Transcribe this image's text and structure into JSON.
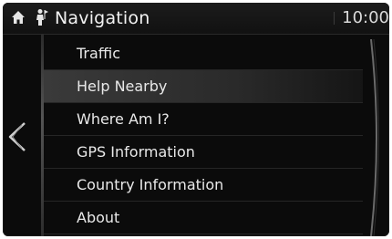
{
  "header": {
    "title": "Navigation",
    "clock": "10:00",
    "home_icon": "home-icon",
    "navigation_icon": "navigation-person-icon"
  },
  "menu": {
    "items": [
      {
        "label": "Traffic",
        "highlighted": false
      },
      {
        "label": "Help Nearby",
        "highlighted": true
      },
      {
        "label": "Where Am I?",
        "highlighted": false
      },
      {
        "label": "GPS Information",
        "highlighted": false
      },
      {
        "label": "Country Information",
        "highlighted": false
      },
      {
        "label": "About",
        "highlighted": false
      }
    ]
  },
  "controls": {
    "back_icon": "chevron-left-icon"
  },
  "colors": {
    "background": "#0b0b0b",
    "text": "#e9e9e9",
    "highlight": "#3a3a3a"
  }
}
